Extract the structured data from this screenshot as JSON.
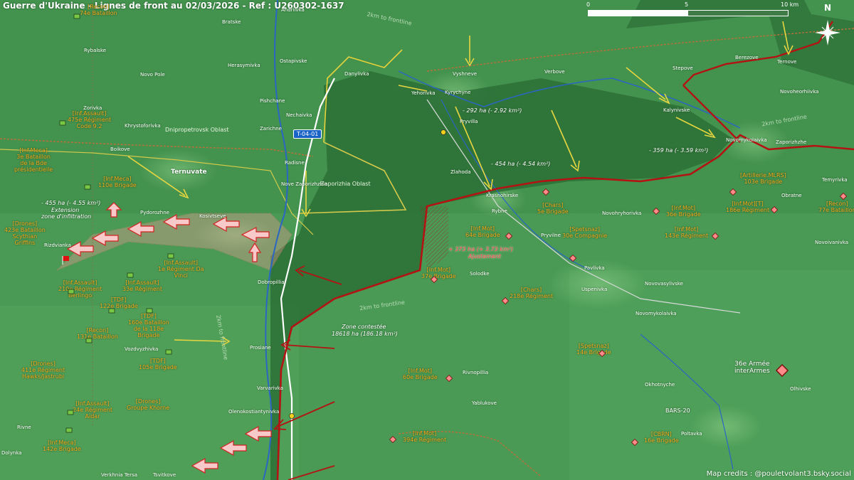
{
  "title": "Guerre d'Ukraine - Lignes de front au 02/03/2026 - Ref : U260302-1637",
  "credits": "Map credits : @pouletvolant3.bsky.social",
  "scale": {
    "ticks": [
      "0",
      "5",
      "10 km"
    ]
  },
  "north_label": "N",
  "road_sign": "T-04-01",
  "oblasts": [
    "Dnipropetrovsk Oblast",
    "Zaporizhia Oblast"
  ],
  "distance_labels": [
    "2km to frontline",
    "2km to frontline",
    "2km to frontline",
    "2km to frontline"
  ],
  "annotations": {
    "area_292": "- 292 ha (- 2.92 km²)",
    "area_359": "- 359 ha (- 3.59 km²)",
    "area_454": "- 454 ha (- 4.54 km²)",
    "area_373": "+ 373 ha (+ 3.73 km²)",
    "adjust": "Ajustement",
    "area_455": "- 455 ha (- 4.55 km²)",
    "extension": "Extension",
    "infiltration": "zone d'infiltration",
    "contested": "Zone contestée",
    "contested_area": "18618 ha (186.18 km²)"
  },
  "towns": [
    "Andriivka",
    "Bratske",
    "Rybalske",
    "Novo Pole",
    "Zorivka",
    "Khrystoforivka",
    "Boikove",
    "Ternuvate",
    "Herasymivka",
    "Ostapivske",
    "Pishchane",
    "Nechaivka",
    "Zarichne",
    "Radisne",
    "Nove Zaporizhzhia",
    "Danylivka",
    "Yehorivka",
    "Vyshneve",
    "Kyrychyne",
    "Pryvilla",
    "Zlahoda",
    "Verbove",
    "Stepove",
    "Ternove",
    "Berezove",
    "Novoheorhiivka",
    "Kalynivske",
    "Zaporizhzhe",
    "Novomykolaivka",
    "Temyrivka",
    "Obratne",
    "Krasnohirske",
    "Rybne",
    "Pryvilne",
    "Novohryhorivka",
    "Novoivanivka",
    "Pavlivka",
    "Uspenivka",
    "Novovasylivske",
    "Solodke",
    "Novomykolaivka",
    "Pydorozhne",
    "Kosivtseve",
    "Rizdvianka",
    "Dobropillia",
    "Prosiane",
    "Vozdvyzhivka",
    "Varvarivka",
    "Olenokostiantynivka",
    "Rivnopillia",
    "Yablukove",
    "Okhotnyche",
    "Olhivske",
    "Poltavka",
    "Rivne",
    "Dolynka",
    "Verkhnia Tersa",
    "Tsvitkove"
  ],
  "units": [
    [
      "[Recon]",
      "74e Bataillon"
    ],
    [
      "[Inf.Assault]",
      "475e Régiment",
      "Code 9.2"
    ],
    [
      "[Inf.Meca]",
      "3e Bataillon",
      "de la Bde",
      "présidentielle"
    ],
    [
      "[Inf.Meca]",
      "110e Brigade"
    ],
    [
      "[Drones]",
      "423e Bataillon",
      "Scythian",
      "Griffins"
    ],
    [
      "[Inf.Assault]",
      "1e Régiment Da",
      "Vinci"
    ],
    [
      "[Inf.Assault]",
      "210e Régiment",
      "Berlingo"
    ],
    [
      "[Inf.Assault]",
      "33e Régiment"
    ],
    [
      "[TDF]",
      "122e Brigade"
    ],
    [
      "[TDF]",
      "160e Bataillon",
      "de la 118e",
      "Brigade"
    ],
    [
      "[Recon]",
      "131e Bataillon"
    ],
    [
      "[Drones]",
      "411e Régiment",
      "Hawks/Jastrubi"
    ],
    [
      "[TDF]",
      "105e Brigade"
    ],
    [
      "[Inf.Assault]",
      "24e Régiment",
      "Aidar"
    ],
    [
      "[Drones]",
      "Groupe Khorne"
    ],
    [
      "[Inf.Meca]",
      "142e Brigade"
    ],
    [
      "[Chars]",
      "5e Brigade"
    ],
    [
      "[Inf.Mot]",
      "64e Brigade"
    ],
    [
      "[Inf.Mot]",
      "37e Brigade"
    ],
    [
      "[Chars]",
      "218e Régiment"
    ],
    [
      "[Spetsnaz]",
      "30e Compagnie"
    ],
    [
      "[Inf.Mot]",
      "36e Brigade"
    ],
    [
      "[Inf.Mot]",
      "143e Régiment"
    ],
    [
      "[Artillerie.MLRS]",
      "103e Brigade"
    ],
    [
      "[Inf.Mot][T]",
      "186e Régiment"
    ],
    [
      "[Recon]",
      "77e Bataillon"
    ],
    [
      "[Spetsnaz]",
      "14e Brigade"
    ],
    [
      "[Inf.Mot]",
      "60e Brigade"
    ],
    [
      "[Inf.Mot]",
      "394e Régiment"
    ],
    [
      "[CBRN]",
      "16e Brigade"
    ],
    [
      "36e Armée",
      "interArmes"
    ],
    [
      "BARS-20"
    ]
  ],
  "colors": {
    "ukr_unit": "#79c843",
    "ru_unit": "#ff8a8a",
    "front_line": "#b31313",
    "contested": "#2d7a3b",
    "label": "#f2a91a"
  }
}
